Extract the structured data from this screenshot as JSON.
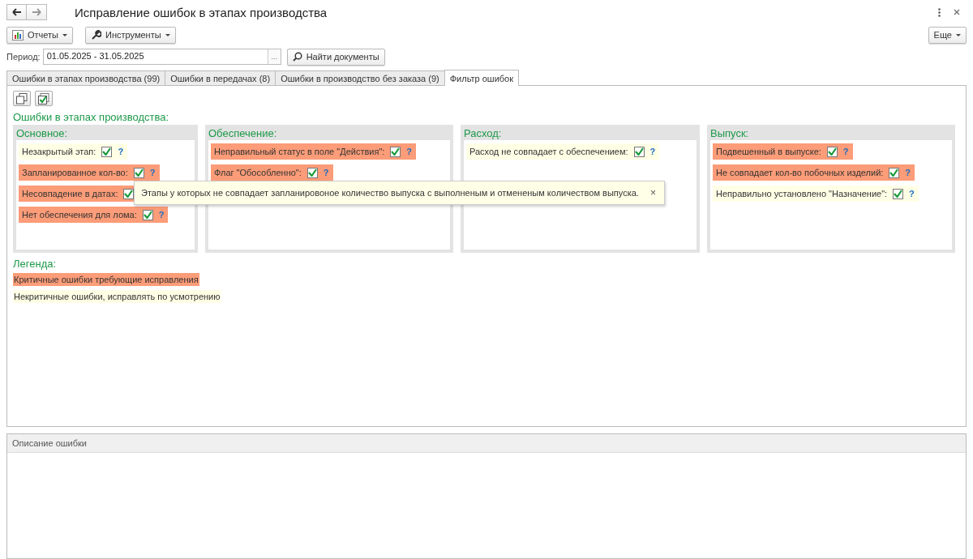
{
  "window": {
    "title": "Исправление ошибок в этапах производства"
  },
  "toolbar": {
    "reports": "Отчеты",
    "tools": "Инструменты",
    "more": "Еще"
  },
  "period": {
    "label": "Период:",
    "value": "01.05.2025 - 31.05.2025",
    "select": "...",
    "find": "Найти документы"
  },
  "tabs": [
    {
      "label": "Ошибки в этапах производства (99)",
      "selected": false
    },
    {
      "label": "Ошибки в передачах (8)",
      "selected": false
    },
    {
      "label": "Ошибки в производство без заказа (9)",
      "selected": false
    },
    {
      "label": "Фильтр ошибок",
      "selected": true
    }
  ],
  "section_title": "Ошибки в этапах производства:",
  "groups": [
    {
      "title": "Основное:",
      "items": [
        {
          "label": "Незакрытый этап:",
          "critical": false,
          "checked": true,
          "help": "?"
        },
        {
          "label": "Запланированное кол-во:",
          "critical": true,
          "checked": true,
          "help": "?"
        },
        {
          "label": "Несовпадение в датах:",
          "critical": true,
          "checked": true
        },
        {
          "label": "Нет обеспечения для лома:",
          "critical": true,
          "checked": true,
          "help": "?"
        }
      ]
    },
    {
      "title": "Обеспечение:",
      "items": [
        {
          "label": "Неправильный статус в поле \"Действия\":",
          "critical": true,
          "checked": true,
          "help": "?"
        },
        {
          "label": "Флаг \"Обособленно\":",
          "critical": true,
          "checked": true,
          "help": "?"
        }
      ]
    },
    {
      "title": "Расход:",
      "items": [
        {
          "label": "Расход не совпадает с обеспечением:",
          "critical": false,
          "checked": true,
          "help": "?"
        }
      ]
    },
    {
      "title": "Выпуск:",
      "items": [
        {
          "label": "Подвешенный в выпуске:",
          "critical": true,
          "checked": true,
          "help": "?"
        },
        {
          "label": "Не совпадает кол-во побочных изделий:",
          "critical": true,
          "checked": true,
          "help": "?"
        },
        {
          "label": "Неправильно установлено \"Назначение\":",
          "critical": false,
          "checked": true,
          "help": "?"
        }
      ]
    }
  ],
  "legend": {
    "title": "Легенда:",
    "items": [
      {
        "label": "Критичные ошибки требующие исправления",
        "critical": true
      },
      {
        "label": "Некритичные ошибки, исправлять по усмотрению",
        "critical": false
      }
    ]
  },
  "tooltip": {
    "text": "Этапы у которых не совпадает запланировоное количество выпуска с выполненым и отмененым количеством выпуска.",
    "close": "×"
  },
  "description": {
    "title": "Описание ошибки"
  }
}
